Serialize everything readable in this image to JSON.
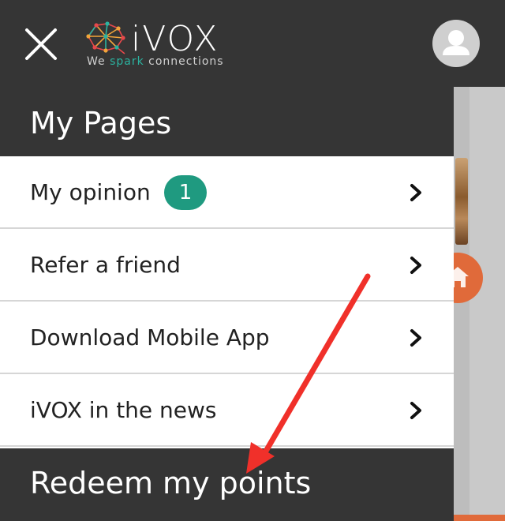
{
  "header": {
    "logo_text": "iVOX",
    "tagline_we": "We",
    "tagline_spark": "spark",
    "tagline_connections": "connections",
    "close_icon": "close-icon",
    "avatar_icon": "user-icon"
  },
  "menu": {
    "section_title": "My Pages",
    "items": [
      {
        "label": "My opinion",
        "badge": "1"
      },
      {
        "label": "Refer a friend"
      },
      {
        "label": "Download Mobile App"
      },
      {
        "label": "iVOX in the news"
      }
    ],
    "redeem_title": "Redeem my points"
  },
  "colors": {
    "header_bg": "#353535",
    "badge": "#1f9a80",
    "annotation_arrow": "#f0302a",
    "accent_orange": "#e06a3a"
  }
}
